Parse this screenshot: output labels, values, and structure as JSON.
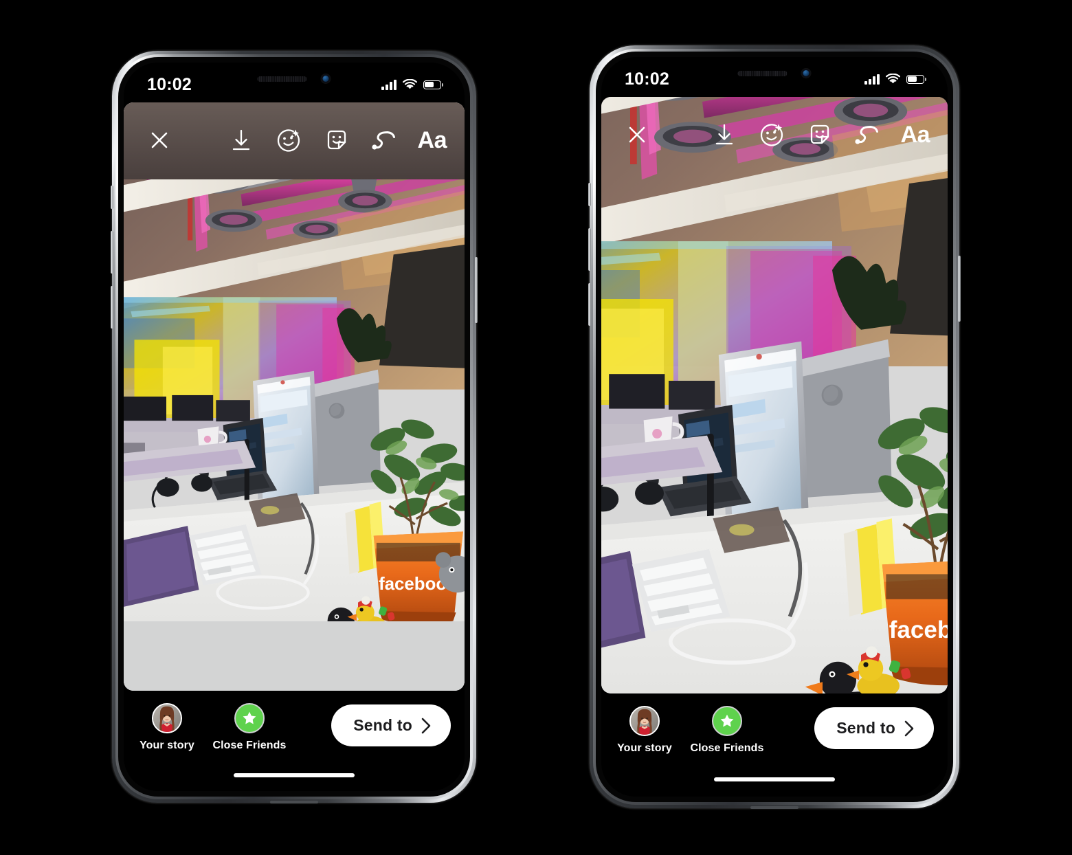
{
  "scene": {
    "background": "#000000",
    "description": "Two iPhone mockups side by side showing Instagram Stories share screen"
  },
  "colors": {
    "accent_green": "#5fd24d",
    "button_white": "#ffffff",
    "button_text": "#1c1c1e",
    "letterbox_top": "#493f3d",
    "letterbox_bottom": "#d3d4d4",
    "frame_silver": "#c9ccd0"
  },
  "phones": [
    {
      "id": "phone-left",
      "variant": "fit",
      "status_bar": {
        "time": "10:02",
        "signal_icon": "cellular-bars-icon",
        "signal_bars": 4,
        "wifi_icon": "wifi-icon",
        "battery_icon": "battery-icon",
        "battery_level_pct": 52
      },
      "toolbar": {
        "close": {
          "label": "Close",
          "icon": "close-icon"
        },
        "actions": [
          {
            "name": "save",
            "icon": "download-icon",
            "label": "Save"
          },
          {
            "name": "effects",
            "icon": "sparkle-face-icon",
            "label": "Effects"
          },
          {
            "name": "stickers",
            "icon": "sticker-icon",
            "label": "Stickers"
          },
          {
            "name": "draw",
            "icon": "squiggle-draw-icon",
            "label": "Draw"
          },
          {
            "name": "text",
            "icon": "text-aa-icon",
            "label": "Aa"
          }
        ]
      },
      "media": {
        "type": "photo",
        "subject": "Office interior with exposed pink-lit ceiling pipes and a desk with iMac, keyboard, mouse, headphones, rubber ducks and an orange facebook plant pot",
        "letterboxed": true,
        "pot_label": "facebook"
      },
      "bottom_bar": {
        "story": {
          "label": "Your story",
          "icon": "avatar"
        },
        "close_friends": {
          "label": "Close Friends",
          "icon": "green-star-icon"
        },
        "send": {
          "label": "Send to",
          "icon": "chevron-right-icon"
        }
      },
      "home_indicator": true
    },
    {
      "id": "phone-right",
      "variant": "fill",
      "status_bar": {
        "time": "10:02",
        "signal_icon": "cellular-bars-icon",
        "signal_bars": 4,
        "wifi_icon": "wifi-icon",
        "battery_icon": "battery-icon",
        "battery_level_pct": 52
      },
      "toolbar": {
        "close": {
          "label": "Close",
          "icon": "close-icon"
        },
        "actions": [
          {
            "name": "save",
            "icon": "download-icon",
            "label": "Save"
          },
          {
            "name": "effects",
            "icon": "sparkle-face-icon",
            "label": "Effects"
          },
          {
            "name": "stickers",
            "icon": "sticker-icon",
            "label": "Stickers"
          },
          {
            "name": "draw",
            "icon": "squiggle-draw-icon",
            "label": "Draw"
          },
          {
            "name": "text",
            "icon": "text-aa-icon",
            "label": "Aa"
          }
        ]
      },
      "media": {
        "type": "photo",
        "subject": "Same office photo cropped and zoomed to fill the screen",
        "letterboxed": false,
        "pot_label": "facebook"
      },
      "bottom_bar": {
        "story": {
          "label": "Your story",
          "icon": "avatar"
        },
        "close_friends": {
          "label": "Close Friends",
          "icon": "green-star-icon"
        },
        "send": {
          "label": "Send to",
          "icon": "chevron-right-icon"
        }
      },
      "home_indicator": true
    }
  ]
}
